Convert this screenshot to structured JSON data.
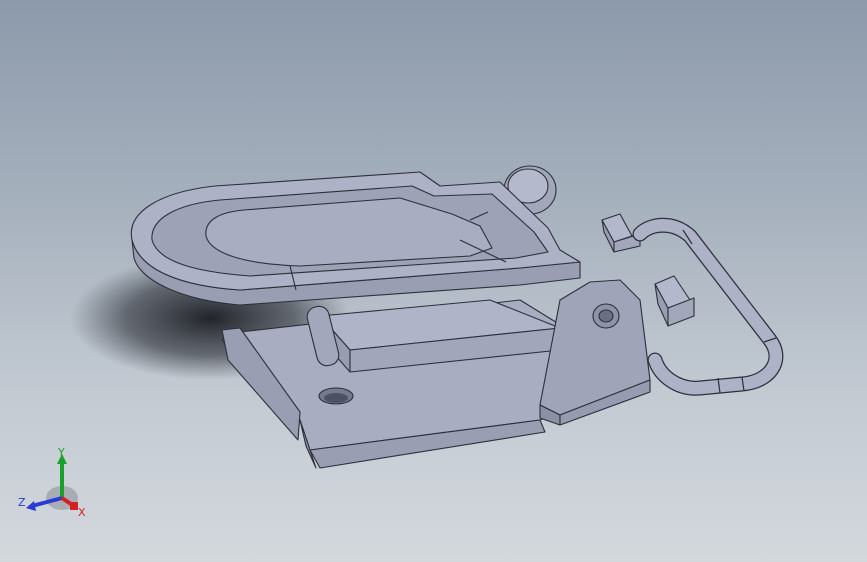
{
  "triad": {
    "y_label": "Y",
    "z_label": "Z",
    "x_label": "X",
    "colors": {
      "x": "#d42020",
      "y": "#1aa02a",
      "z": "#2b3bd6"
    }
  },
  "model": {
    "face_color": "#a9adc2",
    "shadow_face_color": "#8d91a6",
    "edge_color": "#2d2f3a"
  }
}
